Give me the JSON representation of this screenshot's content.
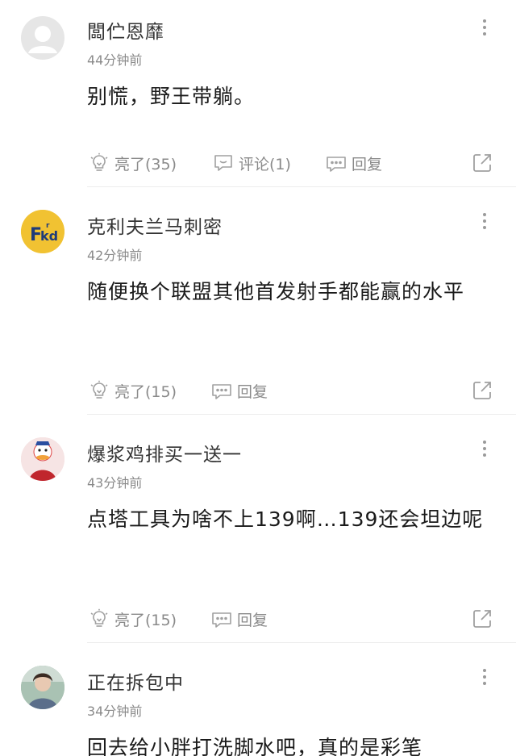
{
  "comments": [
    {
      "username": "闆伫恩靡",
      "time": "44分钟前",
      "text": "别慌，野王带躺。",
      "avatar": "default-avatar-icon",
      "actions": {
        "like": "亮了(35)",
        "comment": "评论(1)",
        "reply": "回复"
      }
    },
    {
      "username": "克利夫兰马刺密",
      "time": "42分钟前",
      "text": "随便换个联盟其他首发射手都能赢的水平",
      "avatar": "fkd-logo",
      "actions": {
        "like": "亮了(15)",
        "reply": "回复"
      }
    },
    {
      "username": "爆浆鸡排买一送一",
      "time": "43分钟前",
      "text": "点塔工具为啥不上139啊…139还会坦边呢",
      "avatar": "cartoon-duck",
      "actions": {
        "like": "亮了(15)",
        "reply": "回复"
      }
    },
    {
      "username": "正在拆包中",
      "time": "34分钟前",
      "text": "回去给小胖打洗脚水吧，真的是彩笔",
      "avatar": "person-photo"
    }
  ],
  "colors": {
    "text": "#1a1a1a",
    "meta": "#8a8a8a",
    "icon": "#9a9a9a",
    "divider": "#ececec"
  }
}
